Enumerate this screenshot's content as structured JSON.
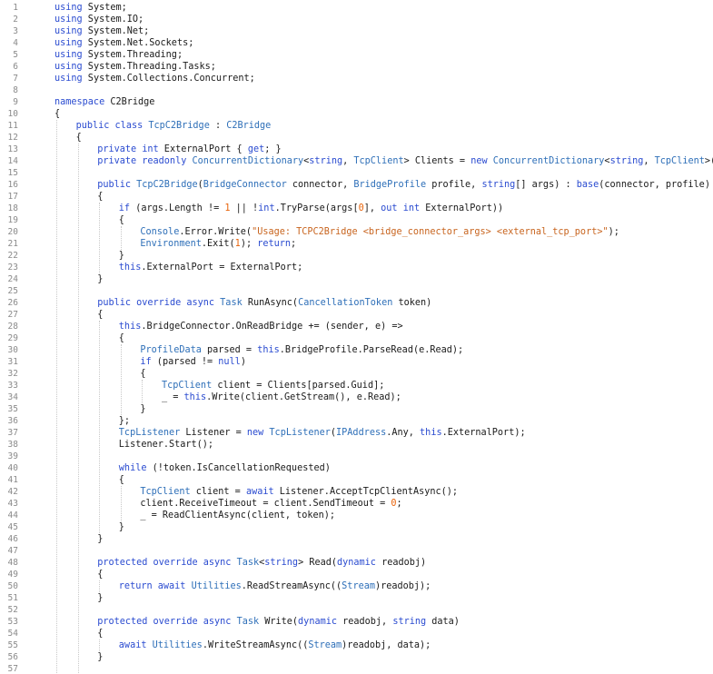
{
  "editor": {
    "language": "csharp",
    "colors": {
      "keyword": "#2a4bd0",
      "type": "#2e6fb8",
      "string": "#c8641e",
      "number": "#e8630a",
      "plain": "#1a1a1a",
      "line_number": "#8a8a8a"
    },
    "lines": [
      {
        "n": "1",
        "indent": 0,
        "t": [
          [
            "k",
            "using"
          ],
          [
            "p",
            " System;"
          ]
        ]
      },
      {
        "n": "2",
        "indent": 0,
        "t": [
          [
            "k",
            "using"
          ],
          [
            "p",
            " System.IO;"
          ]
        ]
      },
      {
        "n": "3",
        "indent": 0,
        "t": [
          [
            "k",
            "using"
          ],
          [
            "p",
            " System.Net;"
          ]
        ]
      },
      {
        "n": "4",
        "indent": 0,
        "t": [
          [
            "k",
            "using"
          ],
          [
            "p",
            " System.Net.Sockets;"
          ]
        ]
      },
      {
        "n": "5",
        "indent": 0,
        "t": [
          [
            "k",
            "using"
          ],
          [
            "p",
            " System.Threading;"
          ]
        ]
      },
      {
        "n": "6",
        "indent": 0,
        "t": [
          [
            "k",
            "using"
          ],
          [
            "p",
            " System.Threading.Tasks;"
          ]
        ]
      },
      {
        "n": "7",
        "indent": 0,
        "t": [
          [
            "k",
            "using"
          ],
          [
            "p",
            " System.Collections.Concurrent;"
          ]
        ]
      },
      {
        "n": "8",
        "indent": 0,
        "t": []
      },
      {
        "n": "9",
        "indent": 0,
        "t": [
          [
            "k",
            "namespace"
          ],
          [
            "p",
            " C2Bridge"
          ]
        ]
      },
      {
        "n": "10",
        "indent": 0,
        "t": [
          [
            "p",
            "{"
          ]
        ]
      },
      {
        "n": "11",
        "indent": 1,
        "t": [
          [
            "k",
            "public"
          ],
          [
            "p",
            " "
          ],
          [
            "k",
            "class"
          ],
          [
            "p",
            " "
          ],
          [
            "y",
            "TcpC2Bridge"
          ],
          [
            "p",
            " : "
          ],
          [
            "y",
            "C2Bridge"
          ]
        ]
      },
      {
        "n": "12",
        "indent": 1,
        "t": [
          [
            "p",
            "{"
          ]
        ]
      },
      {
        "n": "13",
        "indent": 2,
        "t": [
          [
            "k",
            "private"
          ],
          [
            "p",
            " "
          ],
          [
            "k",
            "int"
          ],
          [
            "p",
            " ExternalPort { "
          ],
          [
            "k",
            "get"
          ],
          [
            "p",
            "; }"
          ]
        ]
      },
      {
        "n": "14",
        "indent": 2,
        "t": [
          [
            "k",
            "private"
          ],
          [
            "p",
            " "
          ],
          [
            "k",
            "readonly"
          ],
          [
            "p",
            " "
          ],
          [
            "y",
            "ConcurrentDictionary"
          ],
          [
            "p",
            "<"
          ],
          [
            "k",
            "string"
          ],
          [
            "p",
            ", "
          ],
          [
            "y",
            "TcpClient"
          ],
          [
            "p",
            "> Clients = "
          ],
          [
            "k",
            "new"
          ],
          [
            "p",
            " "
          ],
          [
            "y",
            "ConcurrentDictionary"
          ],
          [
            "p",
            "<"
          ],
          [
            "k",
            "string"
          ],
          [
            "p",
            ", "
          ],
          [
            "y",
            "TcpClient"
          ],
          [
            "p",
            ">();"
          ]
        ]
      },
      {
        "n": "15",
        "indent": 2,
        "t": []
      },
      {
        "n": "16",
        "indent": 2,
        "t": [
          [
            "k",
            "public"
          ],
          [
            "p",
            " "
          ],
          [
            "y",
            "TcpC2Bridge"
          ],
          [
            "p",
            "("
          ],
          [
            "y",
            "BridgeConnector"
          ],
          [
            "p",
            " connector, "
          ],
          [
            "y",
            "BridgeProfile"
          ],
          [
            "p",
            " profile, "
          ],
          [
            "k",
            "string"
          ],
          [
            "p",
            "[] args) : "
          ],
          [
            "k",
            "base"
          ],
          [
            "p",
            "(connector, profile)"
          ]
        ]
      },
      {
        "n": "17",
        "indent": 2,
        "t": [
          [
            "p",
            "{"
          ]
        ]
      },
      {
        "n": "18",
        "indent": 3,
        "t": [
          [
            "k",
            "if"
          ],
          [
            "p",
            " (args.Length != "
          ],
          [
            "n",
            "1"
          ],
          [
            "p",
            " || !"
          ],
          [
            "k",
            "int"
          ],
          [
            "p",
            ".TryParse(args["
          ],
          [
            "n",
            "0"
          ],
          [
            "p",
            "], "
          ],
          [
            "k",
            "out"
          ],
          [
            "p",
            " "
          ],
          [
            "k",
            "int"
          ],
          [
            "p",
            " ExternalPort))"
          ]
        ]
      },
      {
        "n": "19",
        "indent": 3,
        "t": [
          [
            "p",
            "{"
          ]
        ]
      },
      {
        "n": "20",
        "indent": 4,
        "t": [
          [
            "y",
            "Console"
          ],
          [
            "p",
            ".Error.Write("
          ],
          [
            "s",
            "\"Usage: TCPC2Bridge <bridge_connector_args> <external_tcp_port>\""
          ],
          [
            "p",
            ");"
          ]
        ]
      },
      {
        "n": "21",
        "indent": 4,
        "t": [
          [
            "y",
            "Environment"
          ],
          [
            "p",
            ".Exit("
          ],
          [
            "n",
            "1"
          ],
          [
            "p",
            "); "
          ],
          [
            "k",
            "return"
          ],
          [
            "p",
            ";"
          ]
        ]
      },
      {
        "n": "22",
        "indent": 3,
        "t": [
          [
            "p",
            "}"
          ]
        ]
      },
      {
        "n": "23",
        "indent": 3,
        "t": [
          [
            "k",
            "this"
          ],
          [
            "p",
            ".ExternalPort = ExternalPort;"
          ]
        ]
      },
      {
        "n": "24",
        "indent": 2,
        "t": [
          [
            "p",
            "}"
          ]
        ]
      },
      {
        "n": "25",
        "indent": 2,
        "t": []
      },
      {
        "n": "26",
        "indent": 2,
        "t": [
          [
            "k",
            "public"
          ],
          [
            "p",
            " "
          ],
          [
            "k",
            "override"
          ],
          [
            "p",
            " "
          ],
          [
            "k",
            "async"
          ],
          [
            "p",
            " "
          ],
          [
            "y",
            "Task"
          ],
          [
            "p",
            " RunAsync("
          ],
          [
            "y",
            "CancellationToken"
          ],
          [
            "p",
            " token)"
          ]
        ]
      },
      {
        "n": "27",
        "indent": 2,
        "t": [
          [
            "p",
            "{"
          ]
        ]
      },
      {
        "n": "28",
        "indent": 3,
        "t": [
          [
            "k",
            "this"
          ],
          [
            "p",
            ".BridgeConnector.OnReadBridge += (sender, e) =>"
          ]
        ]
      },
      {
        "n": "29",
        "indent": 3,
        "t": [
          [
            "p",
            "{"
          ]
        ]
      },
      {
        "n": "30",
        "indent": 4,
        "t": [
          [
            "y",
            "ProfileData"
          ],
          [
            "p",
            " parsed = "
          ],
          [
            "k",
            "this"
          ],
          [
            "p",
            ".BridgeProfile.ParseRead(e.Read);"
          ]
        ]
      },
      {
        "n": "31",
        "indent": 4,
        "t": [
          [
            "k",
            "if"
          ],
          [
            "p",
            " (parsed != "
          ],
          [
            "k",
            "null"
          ],
          [
            "p",
            ")"
          ]
        ]
      },
      {
        "n": "32",
        "indent": 4,
        "t": [
          [
            "p",
            "{"
          ]
        ]
      },
      {
        "n": "33",
        "indent": 5,
        "t": [
          [
            "y",
            "TcpClient"
          ],
          [
            "p",
            " client = Clients[parsed.Guid];"
          ]
        ]
      },
      {
        "n": "34",
        "indent": 5,
        "t": [
          [
            "p",
            "_ = "
          ],
          [
            "k",
            "this"
          ],
          [
            "p",
            ".Write(client.GetStream(), e.Read);"
          ]
        ]
      },
      {
        "n": "35",
        "indent": 4,
        "t": [
          [
            "p",
            "}"
          ]
        ]
      },
      {
        "n": "36",
        "indent": 3,
        "t": [
          [
            "p",
            "};"
          ]
        ]
      },
      {
        "n": "37",
        "indent": 3,
        "t": [
          [
            "y",
            "TcpListener"
          ],
          [
            "p",
            " Listener = "
          ],
          [
            "k",
            "new"
          ],
          [
            "p",
            " "
          ],
          [
            "y",
            "TcpListener"
          ],
          [
            "p",
            "("
          ],
          [
            "y",
            "IPAddress"
          ],
          [
            "p",
            ".Any, "
          ],
          [
            "k",
            "this"
          ],
          [
            "p",
            ".ExternalPort);"
          ]
        ]
      },
      {
        "n": "38",
        "indent": 3,
        "t": [
          [
            "p",
            "Listener.Start();"
          ]
        ]
      },
      {
        "n": "39",
        "indent": 3,
        "t": []
      },
      {
        "n": "40",
        "indent": 3,
        "t": [
          [
            "k",
            "while"
          ],
          [
            "p",
            " (!token.IsCancellationRequested)"
          ]
        ]
      },
      {
        "n": "41",
        "indent": 3,
        "t": [
          [
            "p",
            "{"
          ]
        ]
      },
      {
        "n": "42",
        "indent": 4,
        "t": [
          [
            "y",
            "TcpClient"
          ],
          [
            "p",
            " client = "
          ],
          [
            "k",
            "await"
          ],
          [
            "p",
            " Listener.AcceptTcpClientAsync();"
          ]
        ]
      },
      {
        "n": "43",
        "indent": 4,
        "t": [
          [
            "p",
            "client.ReceiveTimeout = client.SendTimeout = "
          ],
          [
            "n",
            "0"
          ],
          [
            "p",
            ";"
          ]
        ]
      },
      {
        "n": "44",
        "indent": 4,
        "t": [
          [
            "p",
            "_ = ReadClientAsync(client, token);"
          ]
        ]
      },
      {
        "n": "45",
        "indent": 3,
        "t": [
          [
            "p",
            "}"
          ]
        ]
      },
      {
        "n": "46",
        "indent": 2,
        "t": [
          [
            "p",
            "}"
          ]
        ]
      },
      {
        "n": "47",
        "indent": 2,
        "t": []
      },
      {
        "n": "48",
        "indent": 2,
        "t": [
          [
            "k",
            "protected"
          ],
          [
            "p",
            " "
          ],
          [
            "k",
            "override"
          ],
          [
            "p",
            " "
          ],
          [
            "k",
            "async"
          ],
          [
            "p",
            " "
          ],
          [
            "y",
            "Task"
          ],
          [
            "p",
            "<"
          ],
          [
            "k",
            "string"
          ],
          [
            "p",
            "> Read("
          ],
          [
            "k",
            "dynamic"
          ],
          [
            "p",
            " readobj)"
          ]
        ]
      },
      {
        "n": "49",
        "indent": 2,
        "t": [
          [
            "p",
            "{"
          ]
        ]
      },
      {
        "n": "50",
        "indent": 3,
        "t": [
          [
            "k",
            "return"
          ],
          [
            "p",
            " "
          ],
          [
            "k",
            "await"
          ],
          [
            "p",
            " "
          ],
          [
            "y",
            "Utilities"
          ],
          [
            "p",
            ".ReadStreamAsync(("
          ],
          [
            "y",
            "Stream"
          ],
          [
            "p",
            ")readobj);"
          ]
        ]
      },
      {
        "n": "51",
        "indent": 2,
        "t": [
          [
            "p",
            "}"
          ]
        ]
      },
      {
        "n": "52",
        "indent": 2,
        "t": []
      },
      {
        "n": "53",
        "indent": 2,
        "t": [
          [
            "k",
            "protected"
          ],
          [
            "p",
            " "
          ],
          [
            "k",
            "override"
          ],
          [
            "p",
            " "
          ],
          [
            "k",
            "async"
          ],
          [
            "p",
            " "
          ],
          [
            "y",
            "Task"
          ],
          [
            "p",
            " Write("
          ],
          [
            "k",
            "dynamic"
          ],
          [
            "p",
            " readobj, "
          ],
          [
            "k",
            "string"
          ],
          [
            "p",
            " data)"
          ]
        ]
      },
      {
        "n": "54",
        "indent": 2,
        "t": [
          [
            "p",
            "{"
          ]
        ]
      },
      {
        "n": "55",
        "indent": 3,
        "t": [
          [
            "k",
            "await"
          ],
          [
            "p",
            " "
          ],
          [
            "y",
            "Utilities"
          ],
          [
            "p",
            ".WriteStreamAsync(("
          ],
          [
            "y",
            "Stream"
          ],
          [
            "p",
            ")readobj, data);"
          ]
        ]
      },
      {
        "n": "56",
        "indent": 2,
        "t": [
          [
            "p",
            "}"
          ]
        ]
      },
      {
        "n": "57",
        "indent": 2,
        "t": []
      }
    ]
  }
}
